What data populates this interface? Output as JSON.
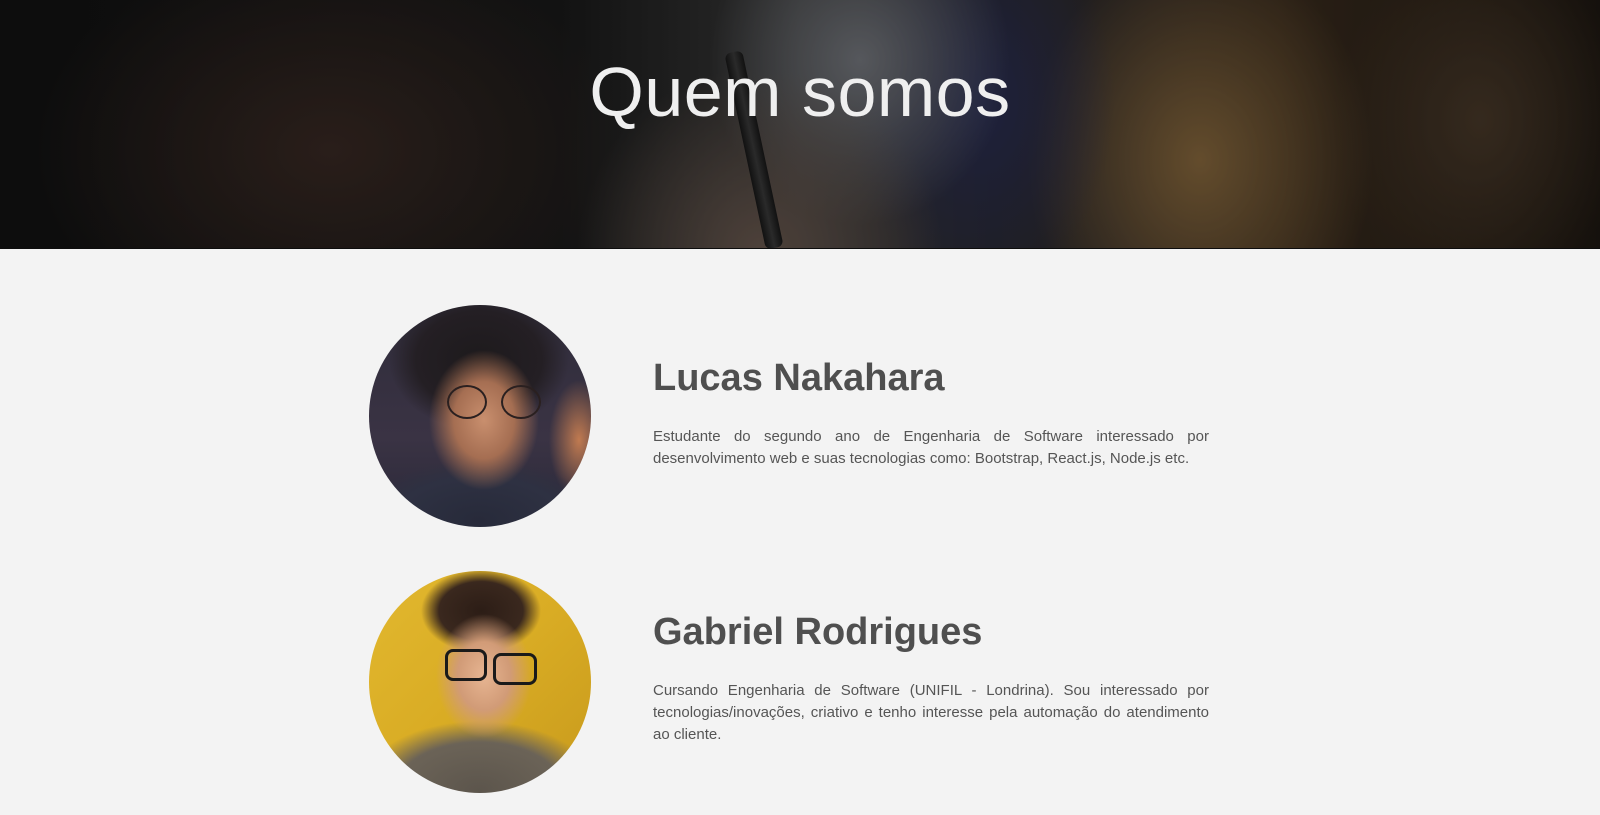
{
  "hero": {
    "title": "Quem somos"
  },
  "team": {
    "members": [
      {
        "name": "Lucas Nakahara",
        "bio": "Estudante do segundo ano de Engenharia de Software interessado por desenvolvimento web e suas tecnologias como: Bootstrap, React.js, Node.js etc."
      },
      {
        "name": "Gabriel Rodrigues",
        "bio": "Cursando Engenharia de Software (UNIFIL - Londrina). Sou interessado por tecnologias/inovações, criativo e tenho interesse pela automação do atendimento ao cliente."
      }
    ]
  },
  "colors": {
    "background": "#f3f3f3",
    "heading": "#4f4f4f",
    "text": "#555555",
    "hero_title": "#efefef"
  }
}
